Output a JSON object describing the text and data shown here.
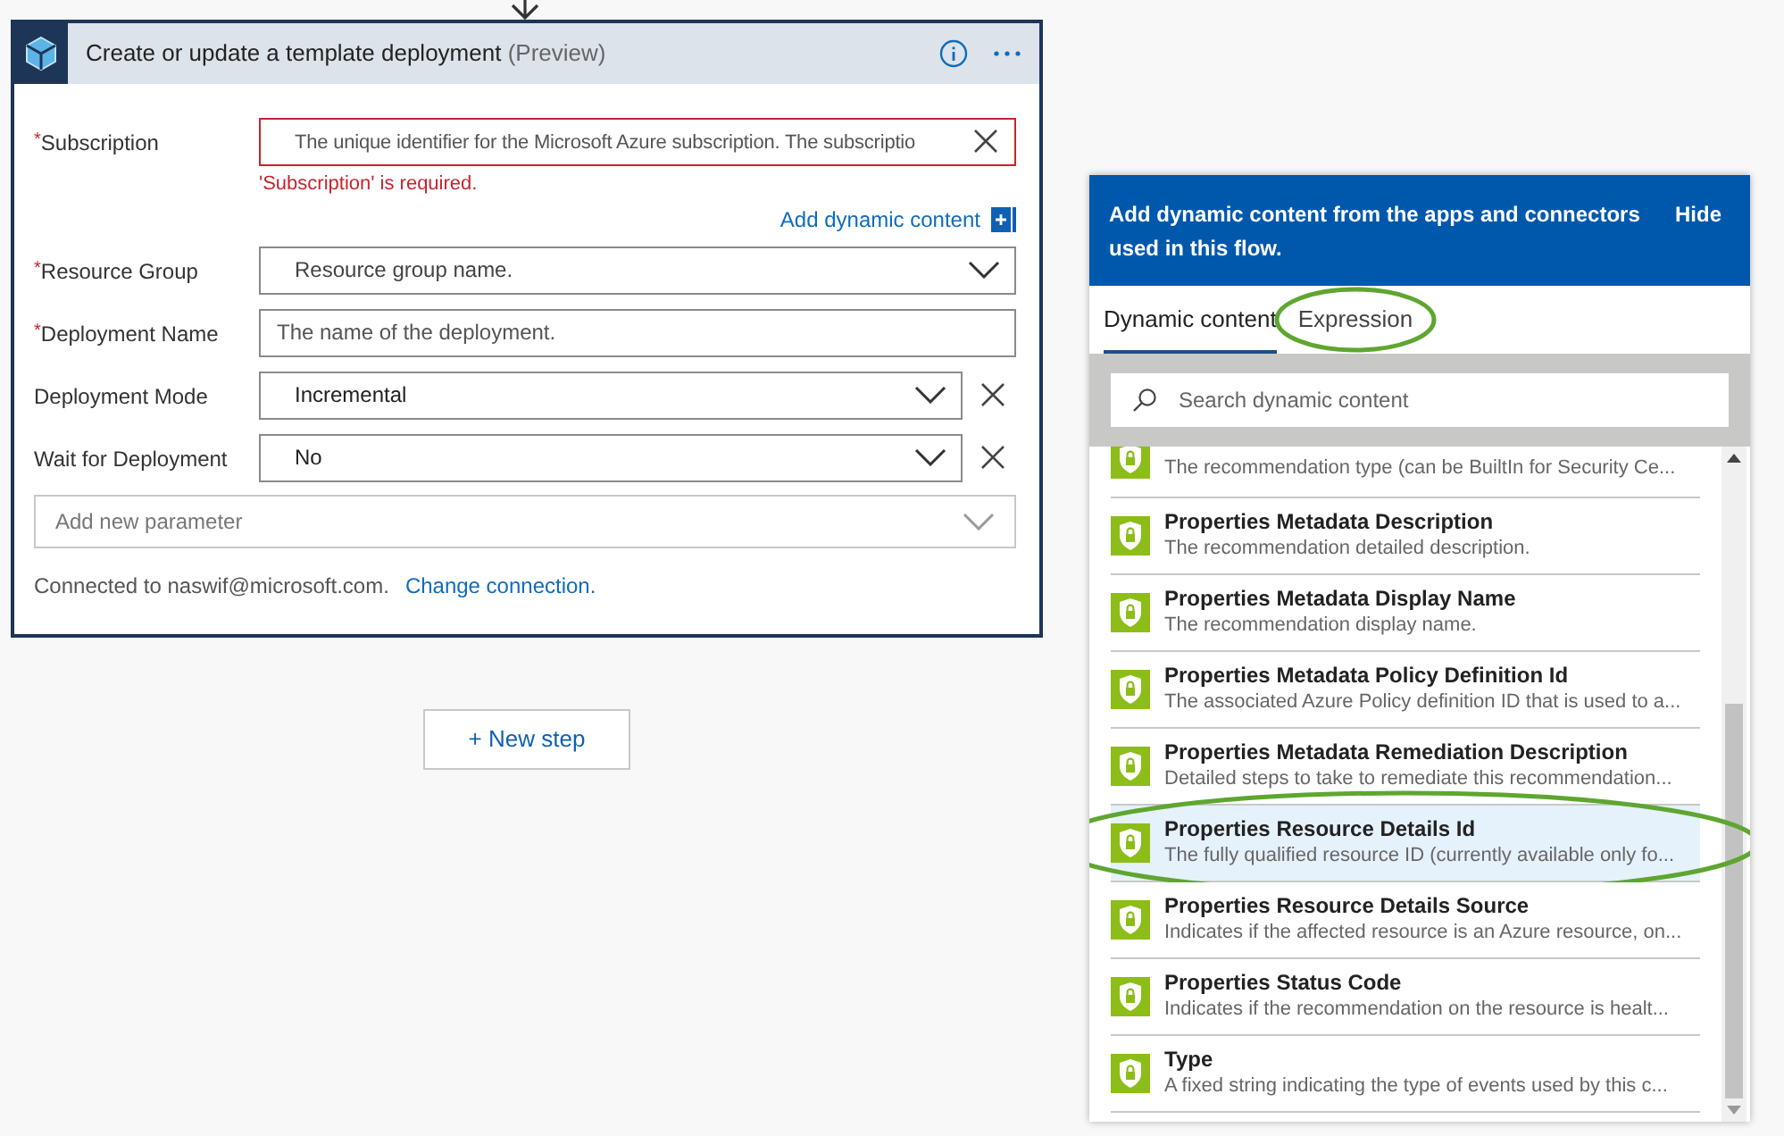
{
  "action_card": {
    "title": "Create or update a template deployment",
    "title_suffix": "(Preview)",
    "fields": [
      {
        "kind": "text",
        "label": "Subscription",
        "required_mark": "*",
        "placeholder": "The unique identifier for the Microsoft Azure subscription. The subscriptio",
        "error": "'Subscription' is required.",
        "clearable": true,
        "removable": false,
        "invalid": true
      },
      {
        "kind": "dropdown",
        "label": "Resource Group",
        "required_mark": "*",
        "placeholder": "Resource group name.",
        "removable": false,
        "invalid": false
      },
      {
        "kind": "text",
        "label": "Deployment Name",
        "required_mark": "*",
        "placeholder": "The name of the deployment.",
        "clearable": false,
        "removable": false,
        "invalid": false
      },
      {
        "kind": "dropdown",
        "label": "Deployment Mode",
        "value": "Incremental",
        "removable": true,
        "invalid": false
      },
      {
        "kind": "dropdown",
        "label": "Wait for Deployment",
        "value": "No",
        "removable": true,
        "invalid": false
      }
    ],
    "add_dynamic_content": "Add dynamic content",
    "add_parameter": {
      "placeholder": "Add new parameter"
    },
    "connection": {
      "text": "Connected to naswif@microsoft.com.",
      "link": "Change connection."
    }
  },
  "new_step_button": "+ New step",
  "dynamic_panel": {
    "header": "Add dynamic content from the apps and connectors used in this flow.",
    "hide": "Hide",
    "tabs": [
      {
        "label": "Dynamic content",
        "selected": true,
        "circled": false
      },
      {
        "label": "Expression",
        "selected": false,
        "circled": true
      }
    ],
    "search": {
      "placeholder": "Search dynamic content"
    },
    "items": [
      {
        "description": "The recommendation type (can be BuiltIn for Security Ce...",
        "selected": false,
        "circled": false
      },
      {
        "title": "Properties Metadata Description",
        "description": "The recommendation detailed description.",
        "selected": false,
        "circled": false
      },
      {
        "title": "Properties Metadata Display Name",
        "description": "The recommendation display name.",
        "selected": false,
        "circled": false
      },
      {
        "title": "Properties Metadata Policy Definition Id",
        "description": "The associated Azure Policy definition ID that is used to a...",
        "selected": false,
        "circled": false
      },
      {
        "title": "Properties Metadata Remediation Description",
        "description": "Detailed steps to take to remediate this recommendation...",
        "selected": false,
        "circled": false
      },
      {
        "title": "Properties Resource Details Id",
        "description": "The fully qualified resource ID (currently available only fo...",
        "selected": true,
        "circled": true
      },
      {
        "title": "Properties Resource Details Source",
        "description": "Indicates if the affected resource is an Azure resource, on...",
        "selected": false,
        "circled": false
      },
      {
        "title": "Properties Status Code",
        "description": "Indicates if the recommendation on the resource is healt...",
        "selected": false,
        "circled": false
      },
      {
        "title": "Type",
        "description": "A fixed string indicating the type of events used by this c...",
        "selected": false,
        "circled": false
      }
    ]
  }
}
